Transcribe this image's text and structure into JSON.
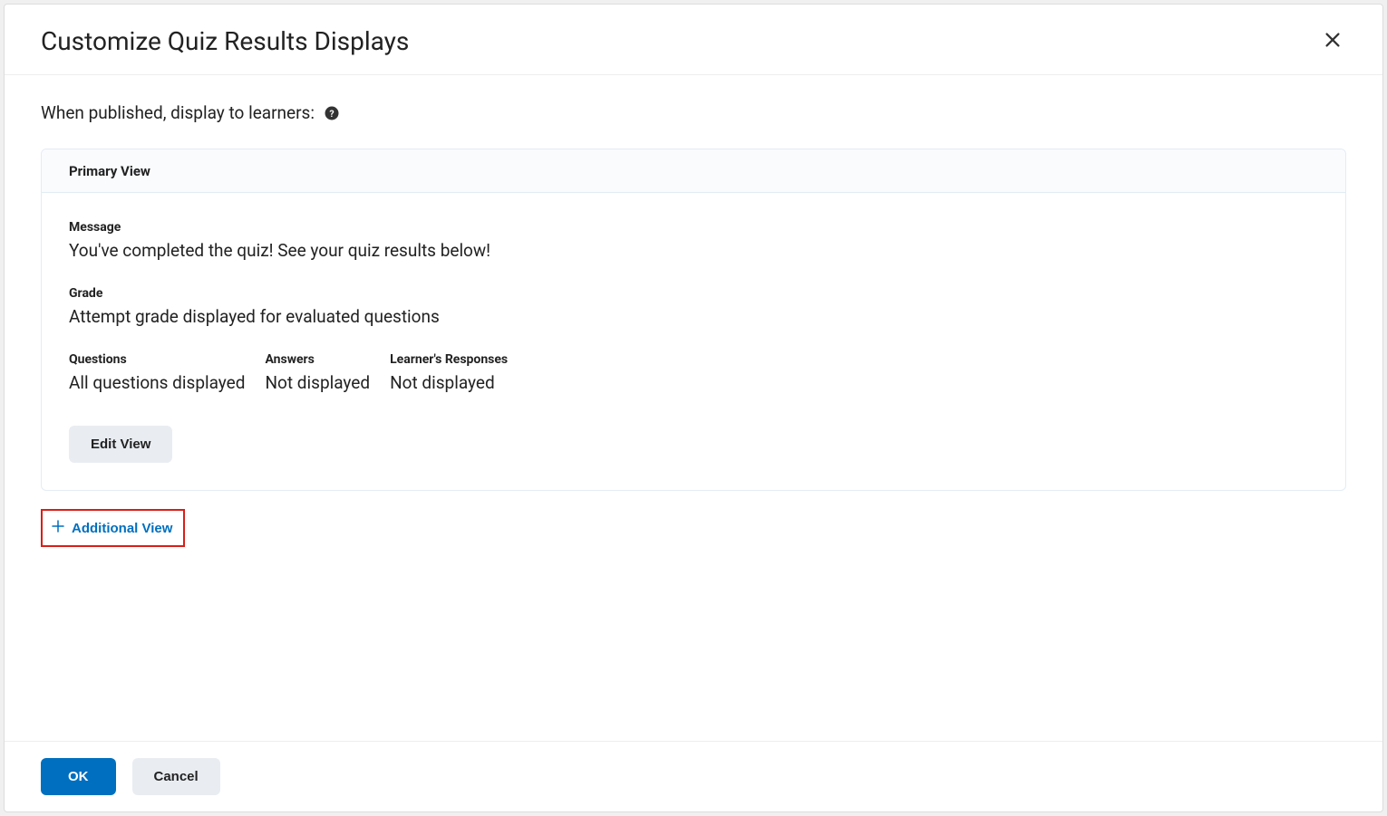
{
  "modal": {
    "title": "Customize Quiz Results Displays",
    "intro": "When published, display to learners:",
    "panel": {
      "header": "Primary View",
      "message_label": "Message",
      "message_value": "You've completed the quiz! See your quiz results below!",
      "grade_label": "Grade",
      "grade_value": "Attempt grade displayed for evaluated questions",
      "columns": [
        {
          "label": "Questions",
          "value": "All questions displayed"
        },
        {
          "label": "Answers",
          "value": "Not displayed"
        },
        {
          "label": "Learner's Responses",
          "value": "Not displayed"
        }
      ],
      "edit_button": "Edit View"
    },
    "additional_view_label": "Additional View",
    "footer": {
      "ok": "OK",
      "cancel": "Cancel"
    }
  }
}
